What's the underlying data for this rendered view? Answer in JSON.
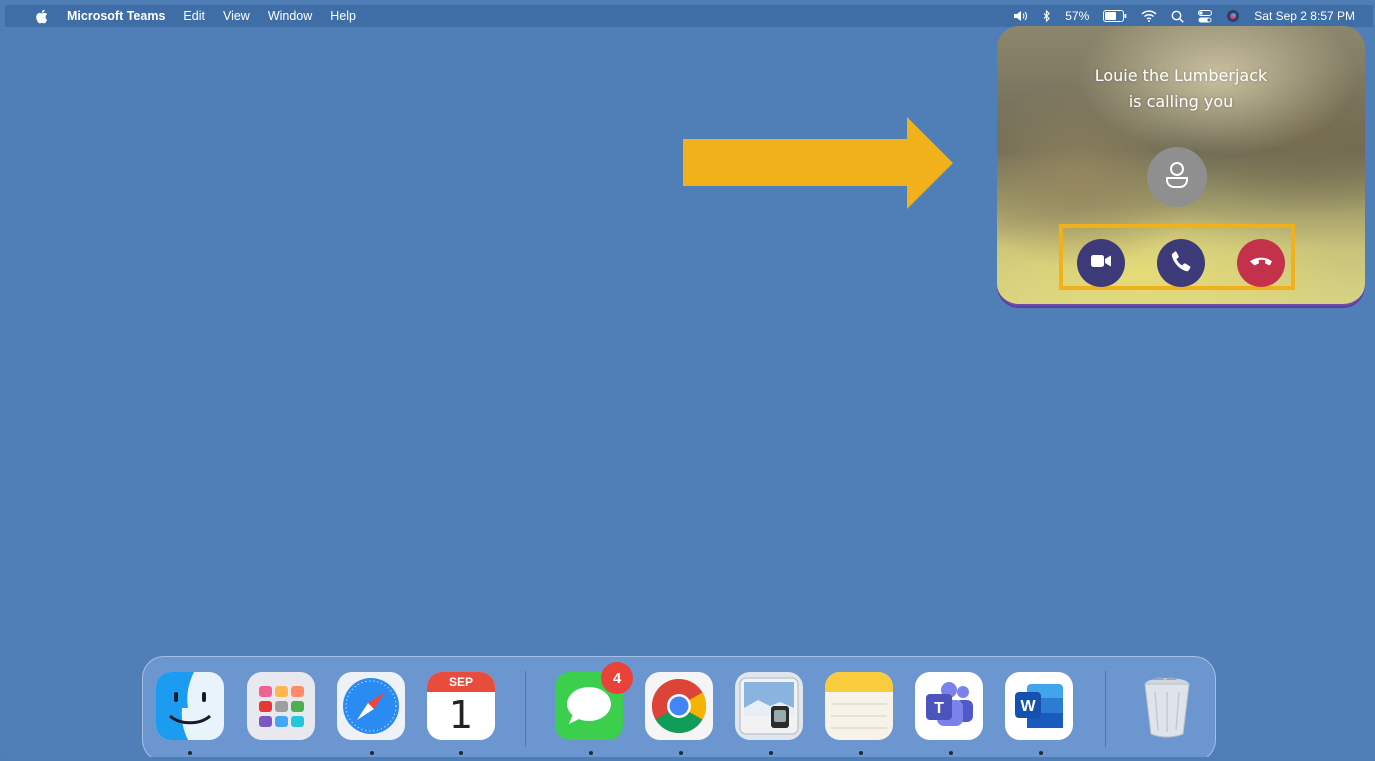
{
  "menubar": {
    "apple_icon": "apple-icon",
    "app_name": "Microsoft Teams",
    "menus": [
      "Edit",
      "View",
      "Window",
      "Help"
    ],
    "battery_percent": "57%",
    "datetime": "Sat Sep 2  8:57 PM"
  },
  "call": {
    "caller_name": "Louie the Lumberjack",
    "subtitle": "is calling you",
    "buttons": {
      "video": "video-camera-icon",
      "audio": "phone-icon",
      "decline": "hang-up-icon"
    }
  },
  "annotation": {
    "arrow_color": "#f0b11a",
    "highlight_color": "#f0b11a"
  },
  "dock": {
    "apps": [
      "Finder",
      "Launchpad",
      "Safari",
      "Calendar",
      "Messages",
      "Google Chrome",
      "Preview",
      "Notes",
      "Microsoft Teams",
      "Microsoft Word",
      "Trash"
    ],
    "calendar_month": "SEP",
    "calendar_day": "1",
    "messages_badge": "4"
  },
  "colors": {
    "desktop": "#507fb8",
    "teams_button": "#3d3a79",
    "decline_button": "#c4314b"
  }
}
